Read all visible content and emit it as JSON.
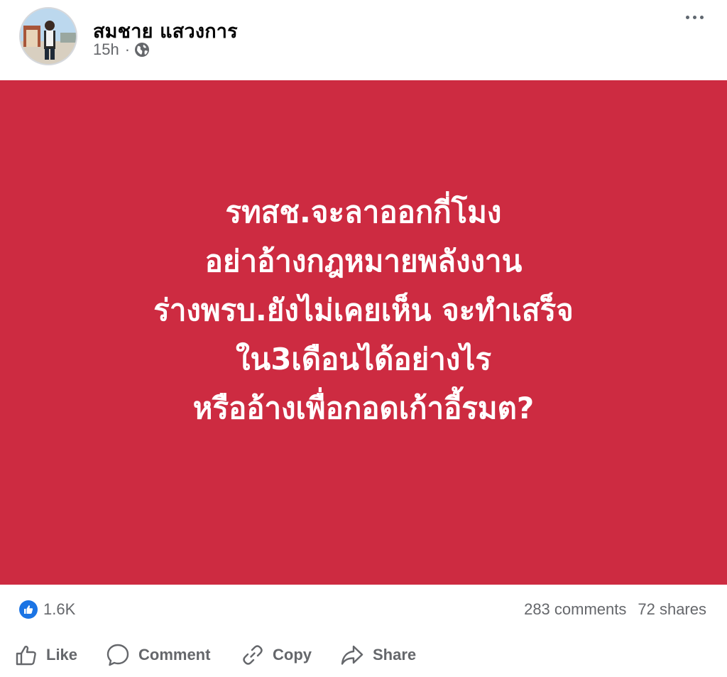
{
  "post": {
    "author_name": "สมชาย แสวงการ",
    "timestamp": "15h",
    "separator": "·",
    "audience_icon": "globe-icon",
    "more_icon": "more-options-icon",
    "image": {
      "background_color": "#cd2b41",
      "text_color": "#ffffff",
      "lines": [
        "รทสช.จะลาออกกี่โมง",
        "อย่าอ้างกฎหมายพลังงาน",
        "ร่างพรบ.ยังไม่เคยเห็น จะทำเสร็จ",
        "ใน3เดือนได้อย่างไร",
        "หรืออ้างเพื่อกอดเก้าอี้รมต?"
      ]
    }
  },
  "stats": {
    "reaction_icon": "like-reaction-icon",
    "reactions_count": "1.6K",
    "comments": "283 comments",
    "shares": "72 shares"
  },
  "actions": {
    "like": {
      "label": "Like",
      "icon": "thumbs-up-icon"
    },
    "comment": {
      "label": "Comment",
      "icon": "comment-bubble-icon"
    },
    "copy": {
      "label": "Copy",
      "icon": "link-icon"
    },
    "share": {
      "label": "Share",
      "icon": "share-arrow-icon"
    }
  },
  "colors": {
    "secondary_text": "#65676b",
    "accent_blue": "#1b74e4"
  }
}
